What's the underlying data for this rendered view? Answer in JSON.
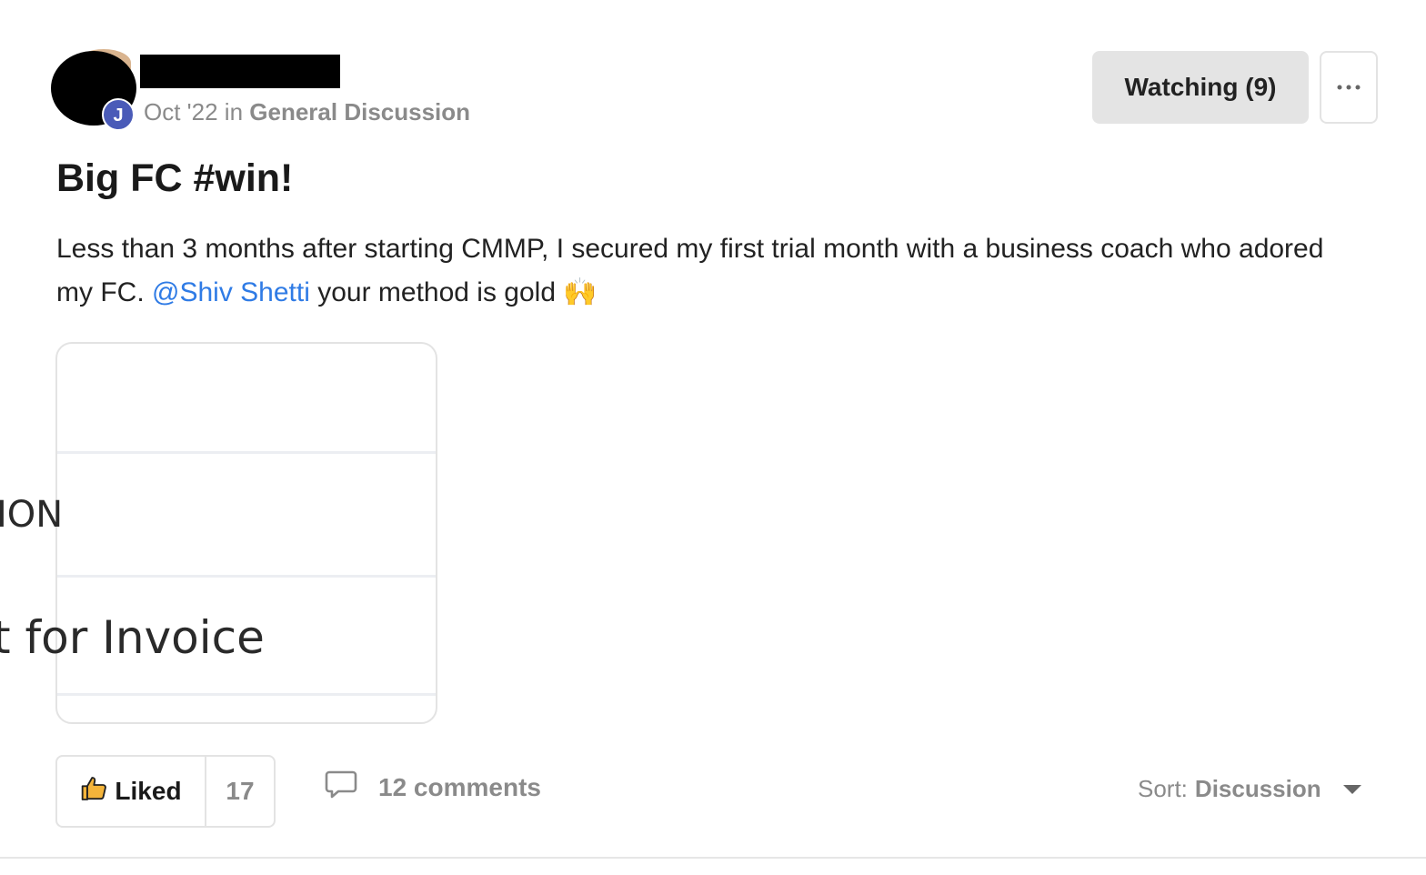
{
  "post": {
    "author_initial": "J",
    "date": "Oct '22",
    "in_word": "in",
    "category": "General Discussion",
    "title": "Big FC #win!",
    "body_part1": "Less than 3 months after starting CMMP, I secured my first trial month with a business coach who adored my FC. ",
    "mention": "@Shiv Shetti",
    "body_part2": " your method is gold 🙌"
  },
  "actions": {
    "watching_label": "Watching (9)"
  },
  "attachment": {
    "line1": "ION",
    "line2": "t for Invoice"
  },
  "footer": {
    "liked_label": "Liked",
    "like_count": "17",
    "comments_label": "12 comments",
    "sort_prefix": "Sort:",
    "sort_value": "Discussion"
  },
  "icons": {
    "like": "thumbs-up-icon",
    "comment": "speech-bubble-icon",
    "more": "ellipsis-icon",
    "sort": "caret-down-icon"
  },
  "colors": {
    "mention": "#2f7be5",
    "badge": "#4a5bb8",
    "watch_bg": "#e4e4e4"
  }
}
